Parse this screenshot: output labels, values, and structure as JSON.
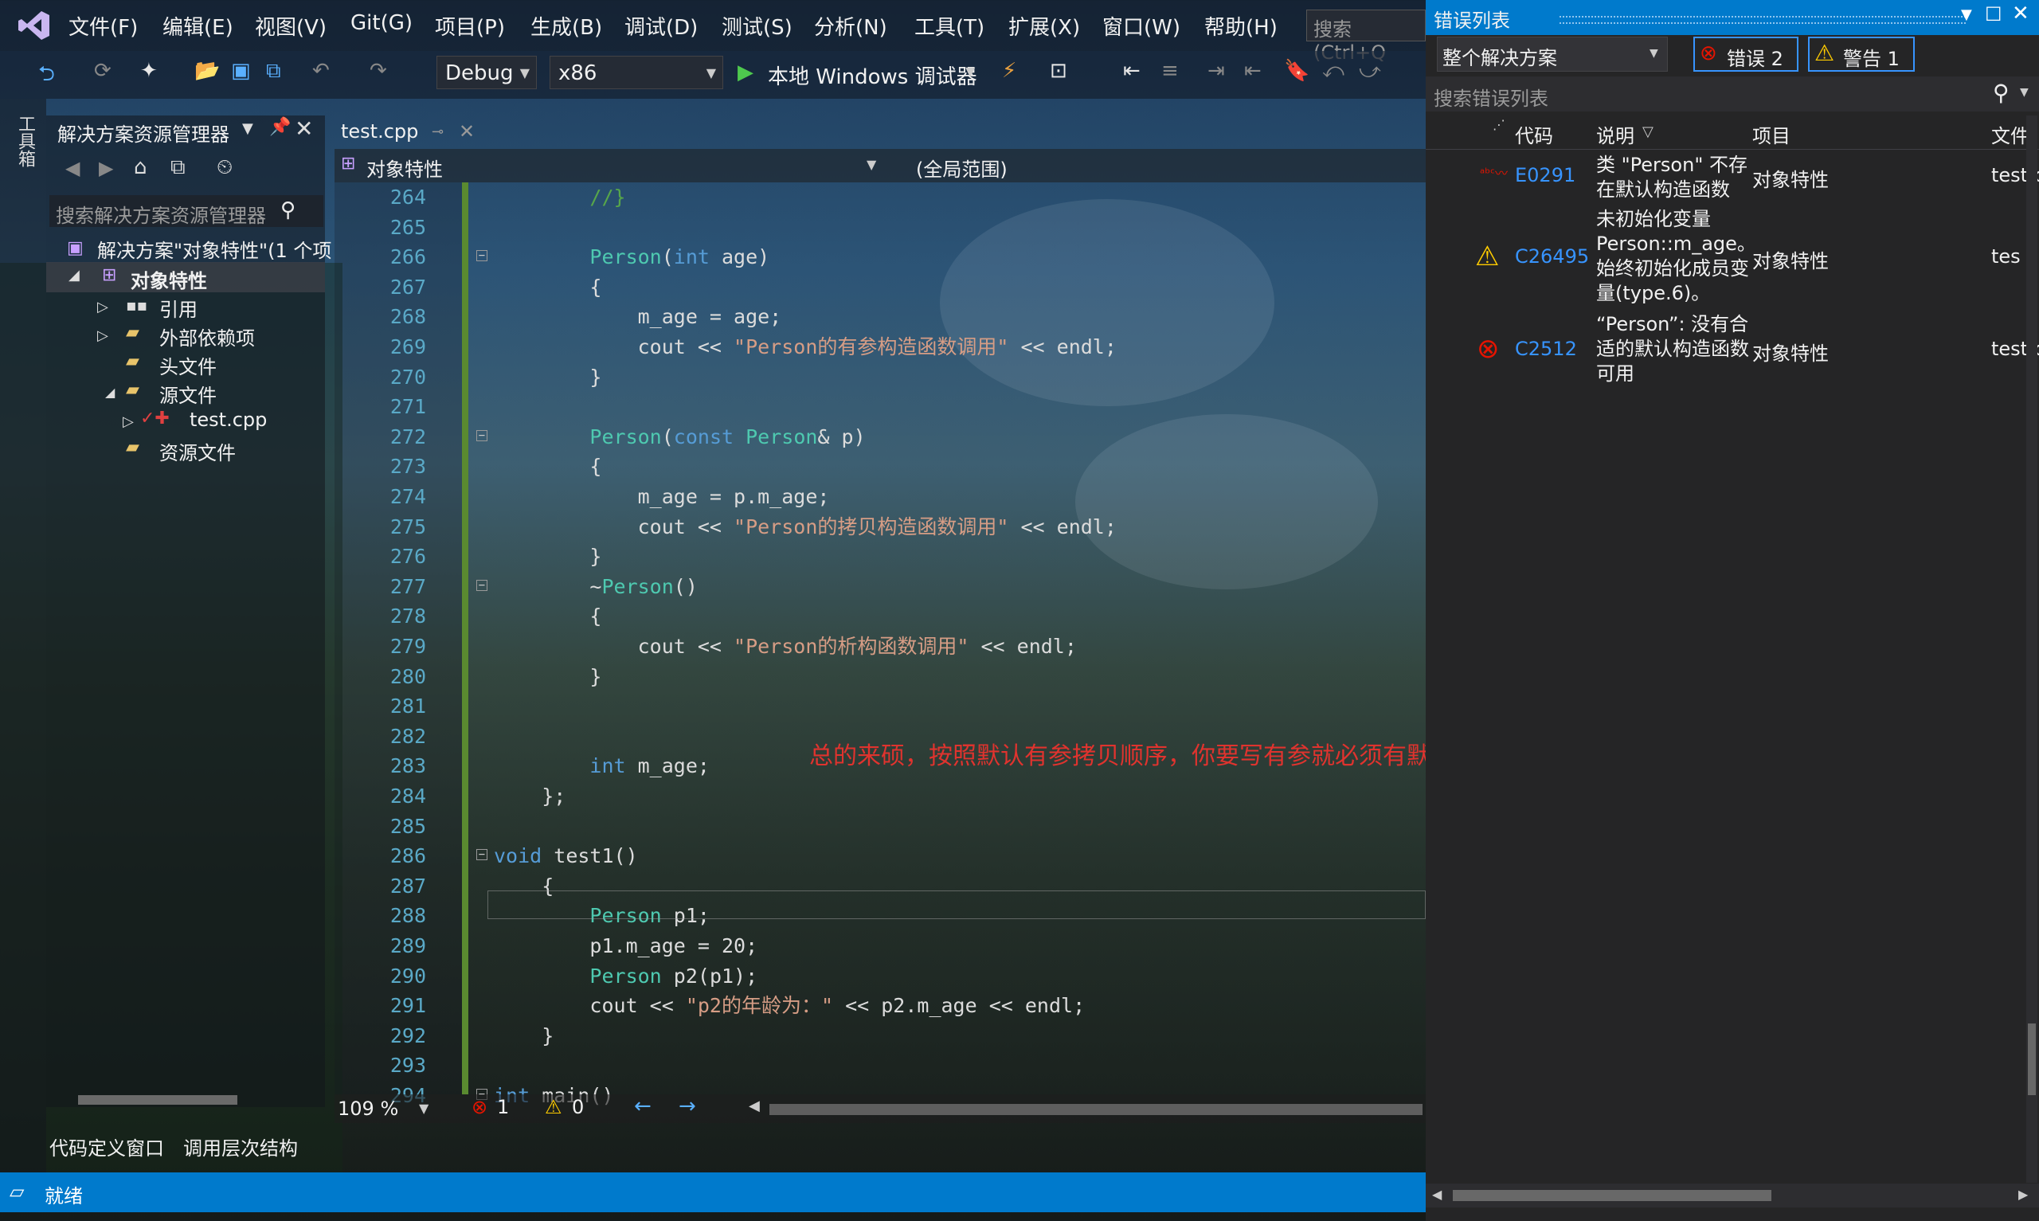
{
  "menu": [
    "文件(F)",
    "编辑(E)",
    "视图(V)",
    "Git(G)",
    "项目(P)",
    "生成(B)",
    "调试(D)",
    "测试(S)",
    "分析(N)",
    "工具(T)",
    "扩展(X)",
    "窗口(W)",
    "帮助(H)"
  ],
  "search_placeholder": "搜索 (Ctrl+Q",
  "toolbar": {
    "config": "Debug",
    "platform": "x86",
    "run_label": "本地 Windows 调试器"
  },
  "left_strip_label": "工具箱",
  "solution_explorer": {
    "title": "解决方案资源管理器",
    "search_placeholder": "搜索解决方案资源管理器",
    "items": [
      {
        "label": "解决方案\"对象特性\"(1 个项"
      },
      {
        "label": "对象特性"
      },
      {
        "label": "引用"
      },
      {
        "label": "外部依赖项"
      },
      {
        "label": "头文件"
      },
      {
        "label": "源文件"
      },
      {
        "label": "test.cpp"
      },
      {
        "label": "资源文件"
      }
    ],
    "bottom_tabs": [
      "代码定义窗口",
      "调用层次结构"
    ]
  },
  "editor": {
    "tab": "test.cpp",
    "scope_left": "对象特性",
    "scope_right": "(全局范围)",
    "zoom": "109 %",
    "error_count": "1",
    "warning_count": "0",
    "annotation": "总的来硕，按照默认有参拷贝顺序，你要写有参就必须有默认，要写拷贝必须有默认和析构",
    "lines": [
      {
        "n": "264",
        "code": "        //}"
      },
      {
        "n": "265",
        "code": ""
      },
      {
        "n": "266",
        "code": "        Person(int age)"
      },
      {
        "n": "267",
        "code": "        {"
      },
      {
        "n": "268",
        "code": "            m_age = age;"
      },
      {
        "n": "269",
        "code": "            cout << \"Person的有参构造函数调用\" << endl;"
      },
      {
        "n": "270",
        "code": "        }"
      },
      {
        "n": "271",
        "code": ""
      },
      {
        "n": "272",
        "code": "        Person(const Person& p)"
      },
      {
        "n": "273",
        "code": "        {"
      },
      {
        "n": "274",
        "code": "            m_age = p.m_age;"
      },
      {
        "n": "275",
        "code": "            cout << \"Person的拷贝构造函数调用\" << endl;"
      },
      {
        "n": "276",
        "code": "        }"
      },
      {
        "n": "277",
        "code": "        ~Person()"
      },
      {
        "n": "278",
        "code": "        {"
      },
      {
        "n": "279",
        "code": "            cout << \"Person的析构函数调用\" << endl;"
      },
      {
        "n": "280",
        "code": "        }"
      },
      {
        "n": "281",
        "code": ""
      },
      {
        "n": "282",
        "code": ""
      },
      {
        "n": "283",
        "code": "        int m_age;"
      },
      {
        "n": "284",
        "code": "    };"
      },
      {
        "n": "285",
        "code": ""
      },
      {
        "n": "286",
        "code": "void test1()"
      },
      {
        "n": "287",
        "code": "    {"
      },
      {
        "n": "288",
        "code": "        Person p1;"
      },
      {
        "n": "289",
        "code": "        p1.m_age = 20;"
      },
      {
        "n": "290",
        "code": "        Person p2(p1);"
      },
      {
        "n": "291",
        "code": "        cout << \"p2的年龄为：\" << p2.m_age << endl;"
      },
      {
        "n": "292",
        "code": "    }"
      },
      {
        "n": "293",
        "code": ""
      },
      {
        "n": "294",
        "code": "int main()"
      }
    ]
  },
  "error_list": {
    "title": "错误列表",
    "scope": "整个解决方案",
    "errors_button": "错误 2",
    "warnings_button": "警告 1",
    "search_placeholder": "搜索错误列表",
    "columns": [
      "代码",
      "说明",
      "项目",
      "文件"
    ],
    "rows": [
      {
        "code": "E0291",
        "desc": "类 \"Person\" 不存在默认构造函数",
        "project": "对象特性",
        "file": "test.c",
        "severity": "error-squiggle"
      },
      {
        "code": "C26495",
        "desc": "未初始化变量 Person::m_age。始终初始化成员变量(type.6)。",
        "project": "对象特性",
        "file": "tes",
        "severity": "warning"
      },
      {
        "code": "C2512",
        "desc": "“Person”: 没有合适的默认构造函数可用",
        "project": "对象特性",
        "file": "test.c",
        "severity": "error"
      }
    ]
  },
  "status": "就绪",
  "colors": {
    "accent": "#007acc",
    "error": "#e51400",
    "warning": "#ffcc00",
    "annotation": "#e0332e"
  }
}
